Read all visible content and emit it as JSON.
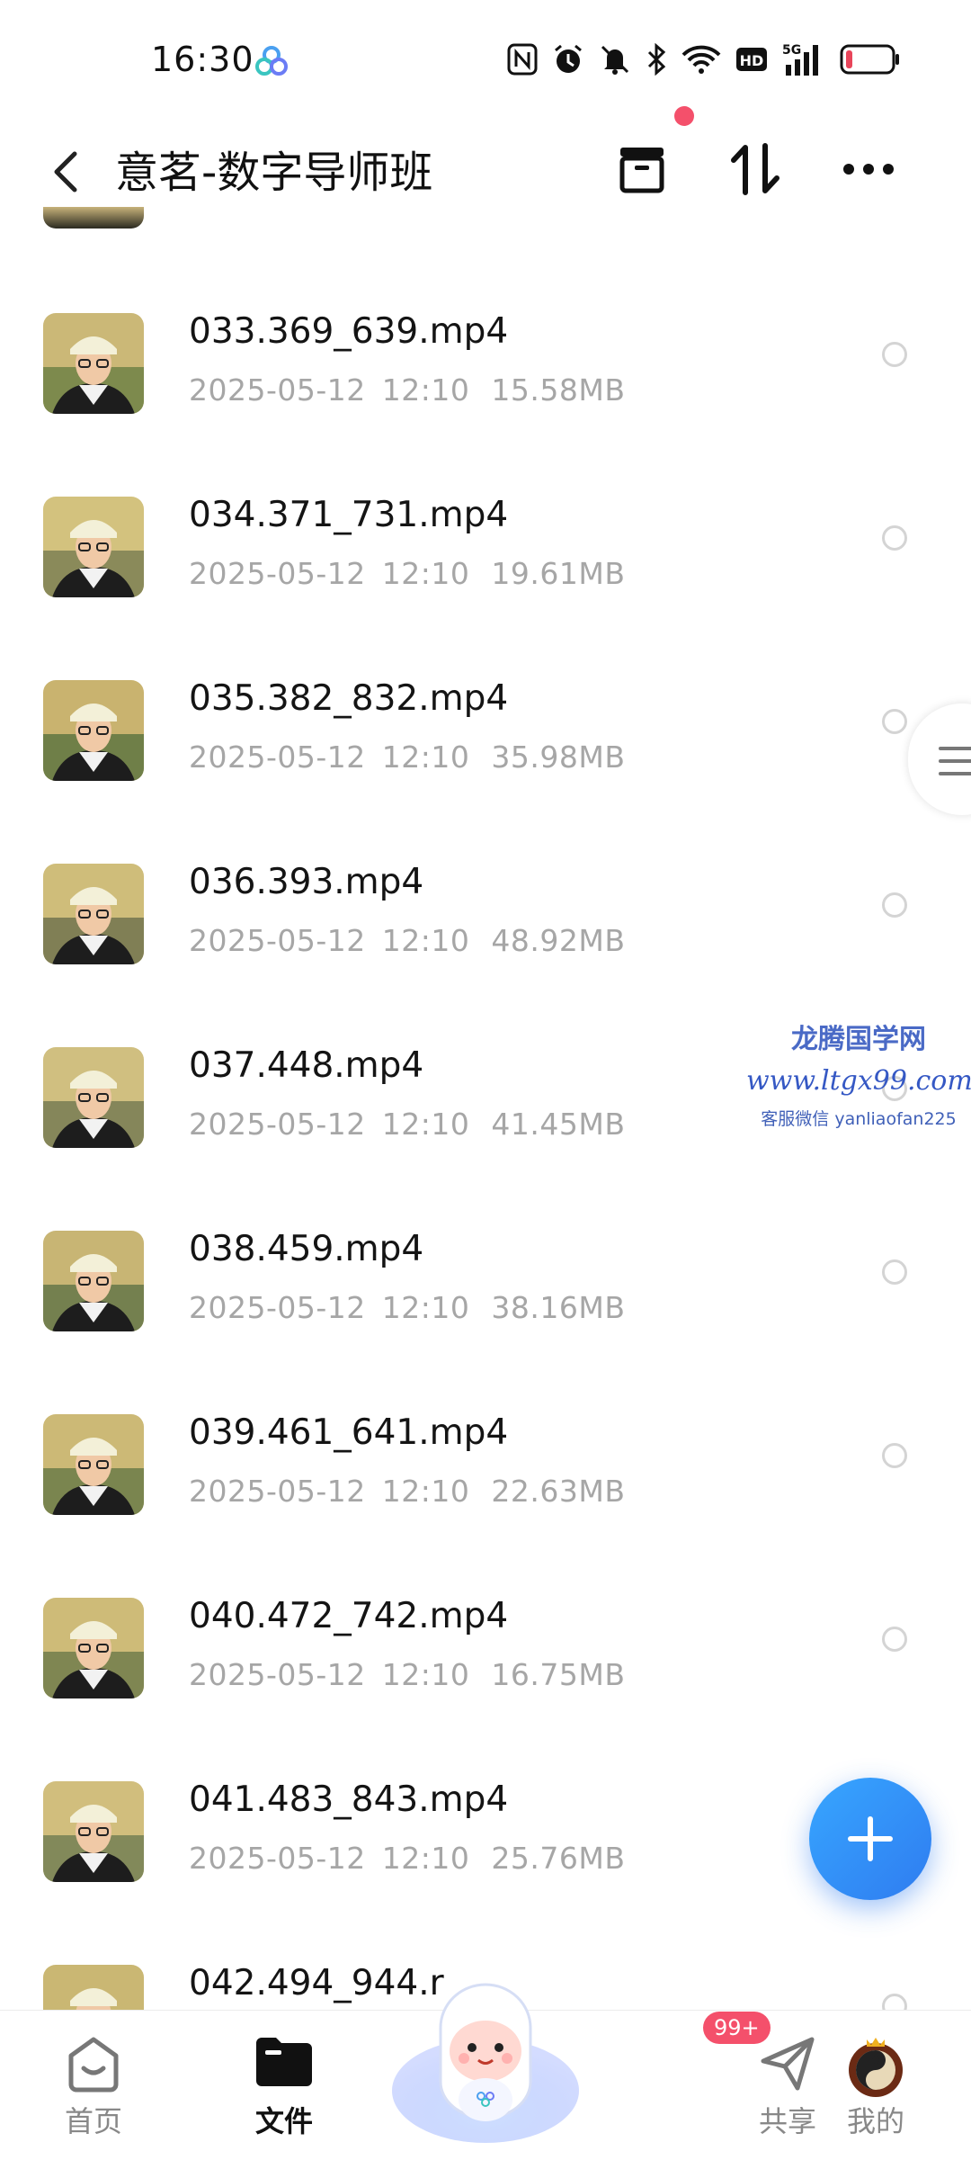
{
  "status_bar": {
    "time": "16:30",
    "icons": [
      "app-logo-icon",
      "nfc-icon",
      "alarm-icon",
      "mute-icon",
      "bluetooth-icon",
      "wifi-icon",
      "hd-icon",
      "signal-5g-icon",
      "battery-low-icon"
    ],
    "battery_color": "#e8455a"
  },
  "header": {
    "title": "意茗-数字导师班",
    "actions": [
      "recent-icon",
      "sort-icon",
      "more-icon"
    ],
    "notification_dot_color": "#f4506b"
  },
  "files": [
    {
      "name": "033.369_639.mp4",
      "date": "2025-05-12",
      "time": "12:10",
      "size": "15.58MB"
    },
    {
      "name": "034.371_731.mp4",
      "date": "2025-05-12",
      "time": "12:10",
      "size": "19.61MB"
    },
    {
      "name": "035.382_832.mp4",
      "date": "2025-05-12",
      "time": "12:10",
      "size": "35.98MB"
    },
    {
      "name": "036.393.mp4",
      "date": "2025-05-12",
      "time": "12:10",
      "size": "48.92MB"
    },
    {
      "name": "037.448.mp4",
      "date": "2025-05-12",
      "time": "12:10",
      "size": "41.45MB"
    },
    {
      "name": "038.459.mp4",
      "date": "2025-05-12",
      "time": "12:10",
      "size": "38.16MB"
    },
    {
      "name": "039.461_641.mp4",
      "date": "2025-05-12",
      "time": "12:10",
      "size": "22.63MB"
    },
    {
      "name": "040.472_742.mp4",
      "date": "2025-05-12",
      "time": "12:10",
      "size": "16.75MB"
    },
    {
      "name": "041.483_843.mp4",
      "date": "2025-05-12",
      "time": "12:10",
      "size": "25.76MB"
    },
    {
      "name": "042.494_944.r",
      "date": "",
      "time": "",
      "size": ""
    }
  ],
  "watermark": {
    "line1": "龙腾国学网",
    "line2": "www.ltgx99.com",
    "line3": "客服微信 yanliaofan225"
  },
  "fab_icon": "plus-icon",
  "bottom_nav": {
    "items": [
      {
        "label": "首页",
        "icon": "home-icon",
        "active": false
      },
      {
        "label": "文件",
        "icon": "folder-icon",
        "active": true
      },
      {
        "label": "",
        "icon": "mascot-icon",
        "active": false
      },
      {
        "label": "共享",
        "icon": "share-icon",
        "active": false
      },
      {
        "label": "我的",
        "icon": "profile-avatar-icon",
        "active": false
      }
    ],
    "share_badge": "99+"
  },
  "colors": {
    "accent": "#2f7cf0",
    "text_secondary": "#a6a6a6",
    "badge": "#f4506b"
  }
}
